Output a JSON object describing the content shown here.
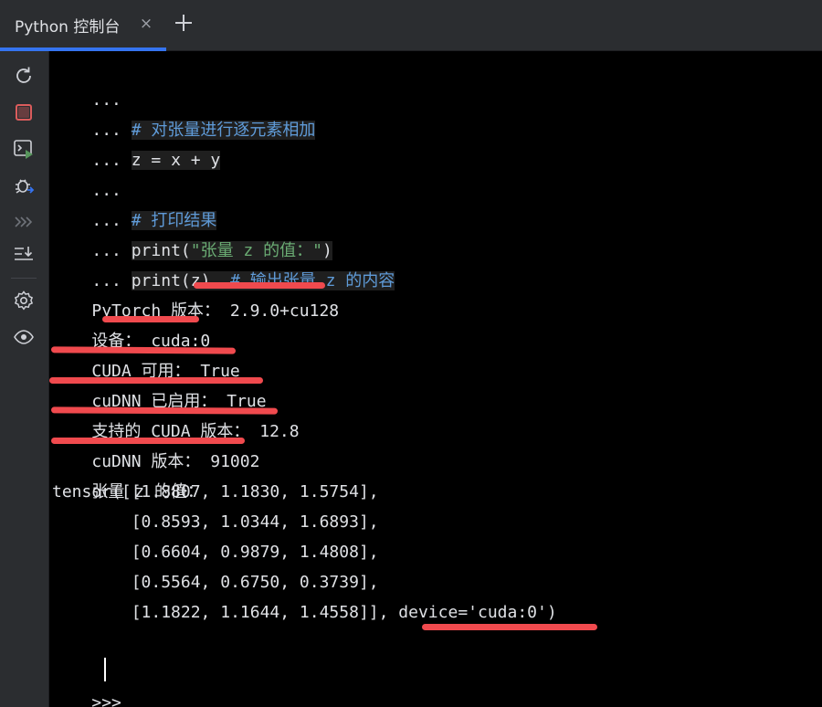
{
  "tab": {
    "title": "Python 控制台",
    "close_glyph": "×",
    "add_icon": "plus-icon"
  },
  "toolbar": {
    "icons": [
      "rerun-icon",
      "stop-icon",
      "run-console-icon",
      "debug-icon",
      "more-icon",
      "scroll-to-end-icon",
      "settings-icon",
      "watch-icon"
    ]
  },
  "colors": {
    "accent": "#3574f0",
    "stop": "#db5c5c",
    "comment": "#5f9bd8",
    "string": "#6aab73",
    "highlight_underline": "#f04a4e",
    "background": "#000000"
  },
  "console": {
    "lines": [
      {
        "prompt": "...",
        "code": ""
      },
      {
        "prompt": "...",
        "code": "# 对张量进行逐元素相加"
      },
      {
        "prompt": "...",
        "code": "z = x + y"
      },
      {
        "prompt": "...",
        "code": ""
      },
      {
        "prompt": "...",
        "code": "# 打印结果"
      },
      {
        "prompt": "...",
        "code_pre": "print(",
        "code_str": "\"张量 z 的值：\"",
        "code_post": ")"
      },
      {
        "prompt": "...",
        "code": "print(z)",
        "code_comment": "# 输出张量 z 的内容"
      }
    ],
    "output": [
      {
        "label": "PyTorch 版本：",
        "value": "2.9.0+cu128"
      },
      {
        "label": "设备：",
        "value": "cuda:0"
      },
      {
        "label": "CUDA 可用：",
        "value": "True"
      },
      {
        "label": "cuDNN 已启用：",
        "value": "True"
      },
      {
        "label": "支持的 CUDA 版本：",
        "value": "12.8"
      },
      {
        "label": "cuDNN 版本：",
        "value": "91002"
      },
      {
        "label": "张量 z 的值：",
        "value": ""
      }
    ],
    "tensor": {
      "rows": [
        "tensor([[1.8807, 1.1830, 1.5754],",
        "        [0.8593, 1.0344, 1.6893],",
        "        [0.6604, 0.9879, 1.4808],",
        "        [0.5564, 0.6750, 0.3739],"
      ],
      "last_row": "        [1.1822, 1.1644, 1.4558]], ",
      "device": "device='cuda:0'",
      "closing": ")"
    },
    "input_prompt": ">>>"
  }
}
